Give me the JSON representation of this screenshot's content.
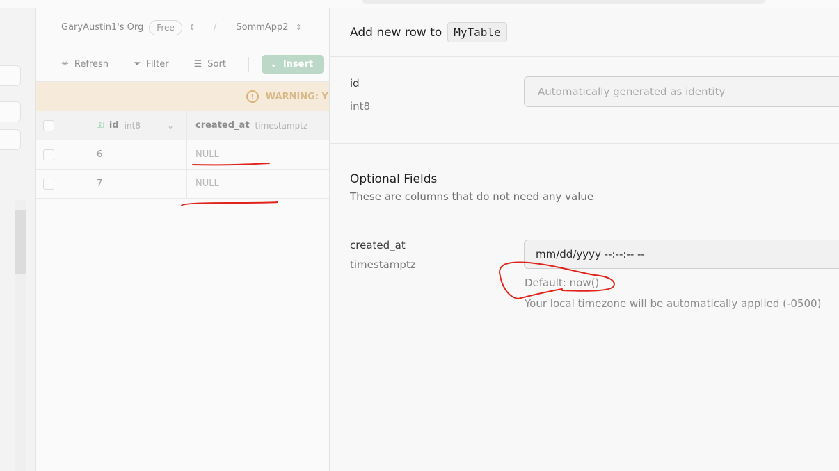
{
  "header": {
    "org": "GaryAustin1's Org",
    "plan_badge": "Free",
    "slash": "/",
    "project": "SommApp2"
  },
  "toolbar": {
    "refresh": "Refresh",
    "filter": "Filter",
    "sort": "Sort",
    "insert": "Insert"
  },
  "warning": {
    "text": "WARNING: Y"
  },
  "grid": {
    "columns": [
      {
        "name": "id",
        "type": "int8"
      },
      {
        "name": "created_at",
        "type": "timestamptz"
      }
    ],
    "rows": [
      {
        "id": "6",
        "created_at": "NULL"
      },
      {
        "id": "7",
        "created_at": "NULL"
      }
    ]
  },
  "panel": {
    "title_prefix": "Add new row to",
    "table_name": "MyTable",
    "id_field": {
      "label": "id",
      "type": "int8",
      "placeholder": "Automatically generated as identity"
    },
    "optional": {
      "title": "Optional Fields",
      "subtitle": "These are columns that do not need any value"
    },
    "created_at_field": {
      "label": "created_at",
      "type": "timestamptz",
      "value": "mm/dd/yyyy --:--:-- --",
      "default_hint": "Default: now()",
      "timezone_hint": "Your local timezone will be automatically applied (-0500)"
    }
  },
  "colors": {
    "annotation": "#e0241c",
    "insert_button": "#bcd8c6",
    "warning_bg": "#f6ebdb"
  }
}
